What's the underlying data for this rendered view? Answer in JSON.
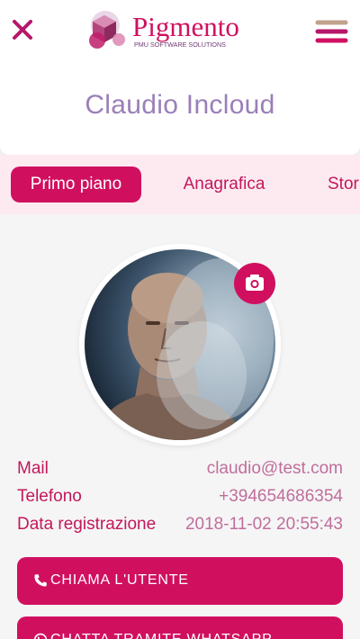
{
  "header": {
    "brand_name": "Pigmento",
    "brand_tagline": "PMU SOFTWARE SOLUTIONS",
    "close_icon": "close-icon",
    "menu_icon": "hamburger-menu-icon"
  },
  "page": {
    "title": "Claudio Incloud"
  },
  "tabs": [
    {
      "label": "Primo piano",
      "active": true
    },
    {
      "label": "Anagrafica",
      "active": false
    },
    {
      "label": "Storia",
      "active": false
    }
  ],
  "profile": {
    "photo": "profile-photo",
    "camera_icon": "camera-icon"
  },
  "info": [
    {
      "label": "Mail",
      "value": "claudio@test.com"
    },
    {
      "label": "Telefono",
      "value": "+394654686354"
    },
    {
      "label": "Data registrazione",
      "value": "2018-11-02 20:55:43"
    }
  ],
  "actions": [
    {
      "label": "CHIAMA L'UTENTE",
      "icon": "phone-icon"
    },
    {
      "label": "CHATTA TRAMITE WHATSAPP",
      "icon": "whatsapp-icon"
    }
  ],
  "colors": {
    "accent": "#d0105f",
    "tab_bar_bg": "#fdeaf1",
    "title_color": "#9a7fb8",
    "label_color": "#c2185b",
    "value_color": "#c06e9c"
  }
}
